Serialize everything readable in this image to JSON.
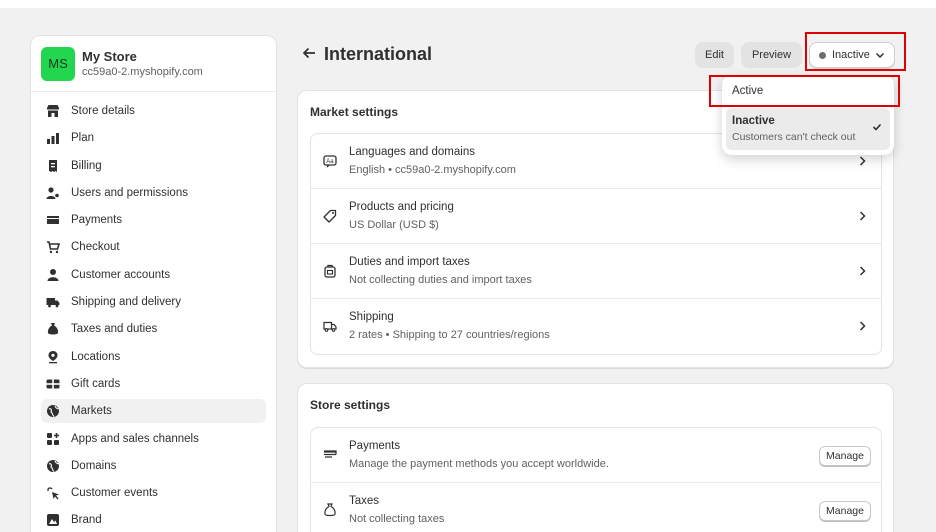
{
  "store": {
    "initials": "MS",
    "name": "My Store",
    "domain": "cc59a0-2.myshopify.com",
    "avatar_color": "#22d64f"
  },
  "sidebar": {
    "items": [
      {
        "label": "Store details",
        "icon": "store-icon",
        "active": false
      },
      {
        "label": "Plan",
        "icon": "plan-icon",
        "active": false
      },
      {
        "label": "Billing",
        "icon": "billing-icon",
        "active": false
      },
      {
        "label": "Users and permissions",
        "icon": "users-icon",
        "active": false
      },
      {
        "label": "Payments",
        "icon": "payments-icon",
        "active": false
      },
      {
        "label": "Checkout",
        "icon": "cart-icon",
        "active": false
      },
      {
        "label": "Customer accounts",
        "icon": "person-icon",
        "active": false
      },
      {
        "label": "Shipping and delivery",
        "icon": "truck-icon",
        "active": false
      },
      {
        "label": "Taxes and duties",
        "icon": "tax-icon",
        "active": false
      },
      {
        "label": "Locations",
        "icon": "location-icon",
        "active": false
      },
      {
        "label": "Gift cards",
        "icon": "gift-card-icon",
        "active": false
      },
      {
        "label": "Markets",
        "icon": "globe-icon",
        "active": true
      },
      {
        "label": "Apps and sales channels",
        "icon": "apps-icon",
        "active": false
      },
      {
        "label": "Domains",
        "icon": "globe-icon",
        "active": false
      },
      {
        "label": "Customer events",
        "icon": "cursor-icon",
        "active": false
      },
      {
        "label": "Brand",
        "icon": "brand-icon",
        "active": false
      }
    ]
  },
  "header": {
    "title": "International",
    "edit_label": "Edit",
    "preview_label": "Preview",
    "status_label": "Inactive"
  },
  "status_dropdown": {
    "options": [
      {
        "label": "Active",
        "description": "",
        "selected": false
      },
      {
        "label": "Inactive",
        "description": "Customers can't check out",
        "selected": true
      }
    ]
  },
  "market_settings": {
    "title": "Market settings",
    "rows": [
      {
        "title": "Languages and domains",
        "subtitle": "English • cc59a0-2.myshopify.com",
        "icon": "language-icon"
      },
      {
        "title": "Products and pricing",
        "subtitle": "US Dollar (USD $)",
        "icon": "price-tag-icon"
      },
      {
        "title": "Duties and import taxes",
        "subtitle": "Not collecting duties and import taxes",
        "icon": "duties-icon"
      },
      {
        "title": "Shipping",
        "subtitle": "2 rates • Shipping to 27 countries/regions",
        "icon": "shipping-icon"
      }
    ]
  },
  "store_settings": {
    "title": "Store settings",
    "rows": [
      {
        "title": "Payments",
        "subtitle": "Manage the payment methods you accept worldwide.",
        "icon": "payments-icon",
        "button": "Manage"
      },
      {
        "title": "Taxes",
        "subtitle": "Not collecting taxes",
        "icon": "tax-icon",
        "button": "Manage"
      }
    ]
  },
  "colors": {
    "highlight": "#e00000",
    "background": "#f1f1f1",
    "surface": "#ffffff"
  }
}
